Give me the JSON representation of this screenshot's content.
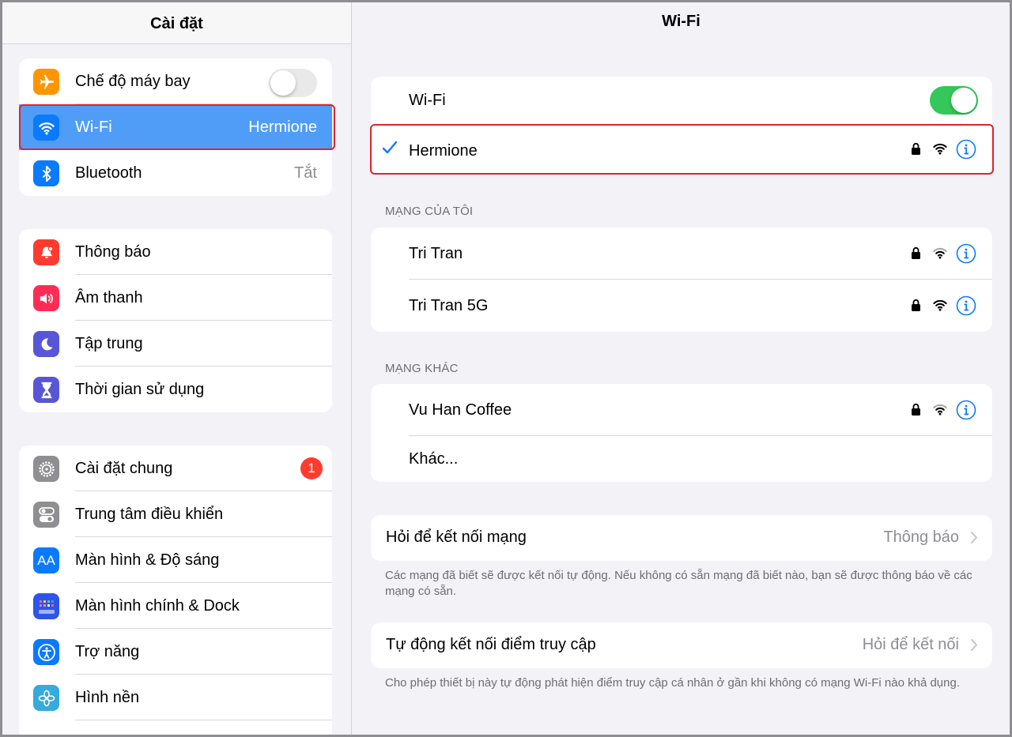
{
  "sidebar": {
    "title": "Cài đặt",
    "group1": [
      {
        "label": "Chế độ máy bay",
        "icon": "airplane-icon",
        "color": "#ff9500",
        "toggle": false
      },
      {
        "label": "Wi-Fi",
        "icon": "wifi-icon",
        "color": "#0a7aff",
        "value": "Hermione",
        "selected": true
      },
      {
        "label": "Bluetooth",
        "icon": "bluetooth-icon",
        "color": "#0a7aff",
        "value": "Tắt"
      }
    ],
    "group2": [
      {
        "label": "Thông báo",
        "icon": "notification-bell-icon",
        "color": "#ff3b30"
      },
      {
        "label": "Âm thanh",
        "icon": "speaker-icon",
        "color": "#ff2d55"
      },
      {
        "label": "Tập trung",
        "icon": "moon-icon",
        "color": "#5856d6"
      },
      {
        "label": "Thời gian sử dụng",
        "icon": "hourglass-icon",
        "color": "#5856d6"
      }
    ],
    "group3": [
      {
        "label": "Cài đặt chung",
        "icon": "gear-icon",
        "color": "#8e8e93",
        "badge": "1"
      },
      {
        "label": "Trung tâm điều khiển",
        "icon": "control-switches-icon",
        "color": "#8e8e93"
      },
      {
        "label": "Màn hình & Độ sáng",
        "icon": "text-size-icon",
        "color": "#0a7aff"
      },
      {
        "label": "Màn hình chính & Dock",
        "icon": "home-grid-icon",
        "color": "#2f54eb"
      },
      {
        "label": "Trợ năng",
        "icon": "accessibility-icon",
        "color": "#0a7aff"
      },
      {
        "label": "Hình nền",
        "icon": "flower-icon",
        "color": "#36aadc"
      }
    ]
  },
  "main": {
    "title": "Wi-Fi",
    "wifi_toggle_label": "Wi-Fi",
    "wifi_on": true,
    "connected_network": "Hermione",
    "my_networks_label": "MẠNG CỦA TÔI",
    "my_networks": [
      "Tri Tran",
      "Tri Tran 5G"
    ],
    "other_networks_label": "MẠNG KHÁC",
    "other_networks": [
      "Vu Han Coffee"
    ],
    "other_label": "Khác...",
    "ask_join": {
      "label": "Hỏi để kết nối mạng",
      "value": "Thông báo"
    },
    "ask_join_note": "Các mạng đã biết sẽ được kết nối tự động. Nếu không có sẵn mạng đã biết nào, bạn sẽ được thông báo về các mạng có sẵn.",
    "auto_hotspot": {
      "label": "Tự động kết nối điểm truy cập",
      "value": "Hỏi để kết nối"
    },
    "auto_hotspot_note": "Cho phép thiết bị này tự động phát hiện điểm truy cập cá nhân ở gần khi không có mạng Wi-Fi nào khả dụng."
  },
  "colors": {
    "accent": "#0a7aff",
    "highlight": "#4f9df7",
    "toggle_on": "#34c759",
    "annotation": "#e0232e"
  }
}
